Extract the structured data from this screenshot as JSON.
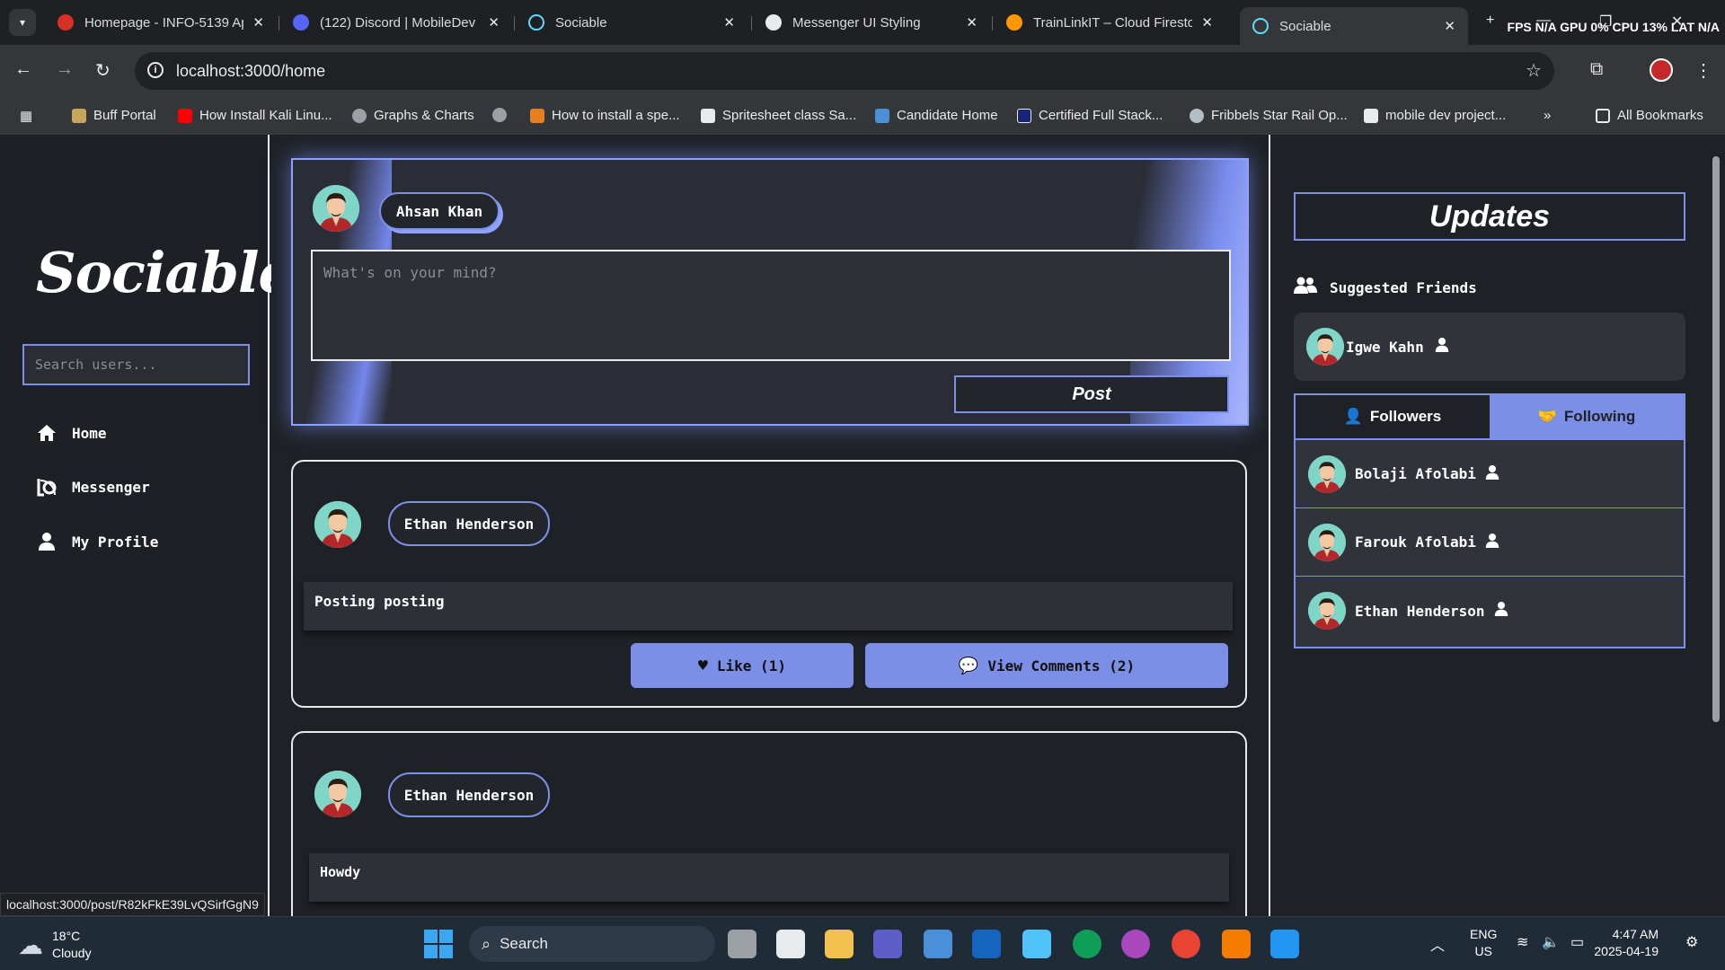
{
  "browser": {
    "tabs": [
      {
        "title": "Homepage - INFO-5139 Ap",
        "color": "#d93025"
      },
      {
        "title": "(122) Discord | MobileDev",
        "color": "#5865f2"
      },
      {
        "title": "Sociable",
        "color": "#61dafb"
      },
      {
        "title": "Messenger UI Styling",
        "color": "#e8eaed"
      },
      {
        "title": "TrainLinkIT – Cloud Firesto",
        "color": "#ff9800"
      },
      {
        "title": "Sociable",
        "color": "#61dafb"
      }
    ],
    "perf": "FPS N/A GPU 0% CPU 13% LAT N/A",
    "url": "localhost:3000/home",
    "bookmarks": [
      {
        "label": "Buff Portal",
        "color": "#c6a75a"
      },
      {
        "label": "How Install Kali Linu...",
        "color": "#ff0000"
      },
      {
        "label": "Graphs & Charts",
        "color": "#9aa0a6"
      },
      {
        "label": "",
        "color": "#9aa0a6"
      },
      {
        "label": "How to install a spe...",
        "color": "#e67e22"
      },
      {
        "label": "Spritesheet class Sa...",
        "color": "#e8eaed"
      },
      {
        "label": "Candidate Home",
        "color": "#4a90d9"
      },
      {
        "label": "Certified Full Stack...",
        "color": "#1a237e"
      },
      {
        "label": "Fribbels Star Rail Op...",
        "color": "#b0bec5"
      },
      {
        "label": "mobile dev project...",
        "color": "#e8eaed"
      }
    ],
    "all_bookmarks": "All Bookmarks",
    "status_url": "localhost:3000/post/R82kFkE39LvQSirfGgN9"
  },
  "sidebar": {
    "logo": "Sociable",
    "search_placeholder": "Search users...",
    "nav": [
      {
        "label": "Home",
        "icon": "home-icon"
      },
      {
        "label": "Messenger",
        "icon": "messenger-icon"
      },
      {
        "label": "My Profile",
        "icon": "user-icon"
      }
    ]
  },
  "composer": {
    "user": "Ahsan Khan",
    "placeholder": "What's on your mind?",
    "post_label": "Post"
  },
  "posts": [
    {
      "author": "Ethan Henderson",
      "content": "Posting posting",
      "like_label": "Like (1)",
      "comments_label": "View Comments (2)"
    },
    {
      "author": "Ethan Henderson",
      "content": "Howdy"
    }
  ],
  "updates": {
    "title": "Updates",
    "suggested_title": "Suggested Friends",
    "suggested": [
      {
        "name": "Igwe Kahn"
      }
    ],
    "tabs": {
      "followers": "Followers",
      "following": "Following"
    },
    "following": [
      {
        "name": "Bolaji Afolabi"
      },
      {
        "name": "Farouk Afolabi"
      },
      {
        "name": "Ethan Henderson"
      }
    ]
  },
  "taskbar": {
    "weather_temp": "18°C",
    "weather_desc": "Cloudy",
    "search_label": "Search",
    "lang": "ENG",
    "region": "US",
    "time": "4:47 AM",
    "date": "2025-04-19"
  },
  "colors": {
    "accent": "#7b8fe6",
    "background": "#1e2126"
  }
}
